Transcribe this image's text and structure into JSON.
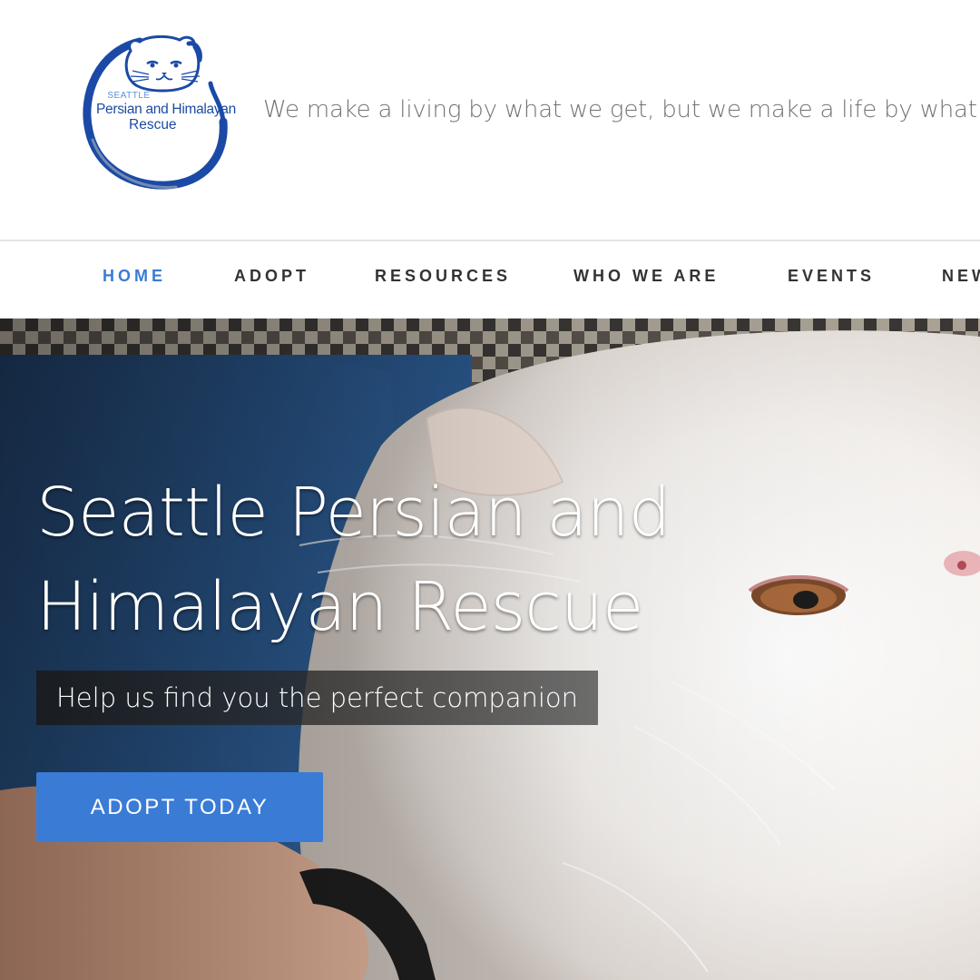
{
  "header": {
    "logo": {
      "small_text": "SEATTLE",
      "line1": "Persian and Himalayan",
      "line2": "Rescue",
      "icon": "cat-face-logo-icon"
    },
    "tagline": "We make a living by what we get, but we make a life by what we give."
  },
  "nav": {
    "items": [
      {
        "label": "HOME",
        "active": true
      },
      {
        "label": "ADOPT",
        "active": false
      },
      {
        "label": "RESOURCES",
        "active": false
      },
      {
        "label": "WHO WE ARE",
        "active": false
      },
      {
        "label": "EVENTS",
        "active": false
      },
      {
        "label": "NEWS",
        "active": false
      }
    ],
    "active_color": "#3a7bd5",
    "text_color": "#333333"
  },
  "hero": {
    "title_line1": "Seattle Persian and",
    "title_line2": "Himalayan Rescue",
    "subtitle": "Help us find you the perfect companion",
    "button_label": "ADOPT TODAY",
    "button_color": "#3a7bd5",
    "background": "white-persian-cat-photo"
  }
}
